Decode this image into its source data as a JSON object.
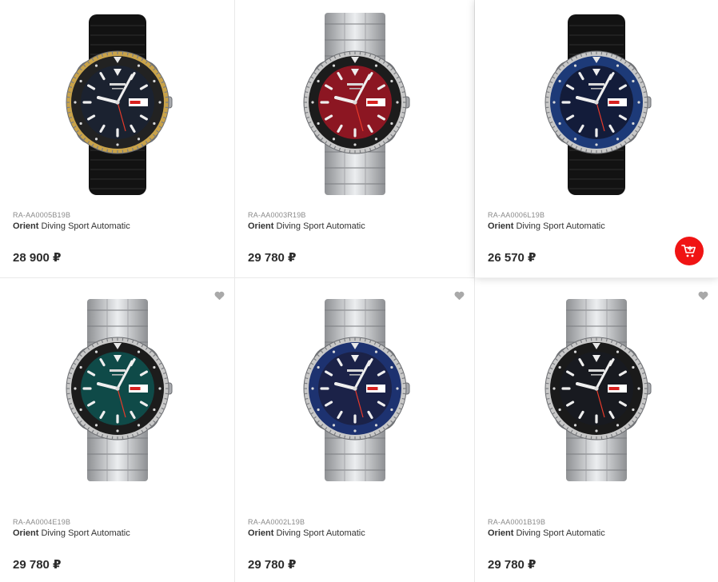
{
  "currency": "₽",
  "accent_color": "#f01414",
  "products": [
    {
      "sku": "RA-AA0005B19B",
      "brand": "Orient",
      "model": "Diving Sport Automatic",
      "price": "28 900 ₽",
      "dial_color": "#1b2230",
      "bezel_color": "#222222",
      "ring_color": "#c9a34a",
      "strap": "rubber",
      "favorite_icon": false,
      "cart_icon": false
    },
    {
      "sku": "RA-AA0003R19B",
      "brand": "Orient",
      "model": "Diving Sport Automatic",
      "price": "29 780 ₽",
      "dial_color": "#8c1622",
      "bezel_color": "#1c1c1c",
      "ring_color": "#c8c8c8",
      "strap": "steel",
      "favorite_icon": false,
      "cart_icon": false
    },
    {
      "sku": "RA-AA0006L19B",
      "brand": "Orient",
      "model": "Diving Sport Automatic",
      "price": "26 570 ₽",
      "dial_color": "#131c3a",
      "bezel_color": "#1d3a78",
      "ring_color": "#c8c8c8",
      "strap": "rubber",
      "favorite_icon": false,
      "cart_icon": true
    },
    {
      "sku": "RA-AA0004E19B",
      "brand": "Orient",
      "model": "Diving Sport Automatic",
      "price": "29 780 ₽",
      "dial_color": "#0f4a48",
      "bezel_color": "#1c1c1c",
      "ring_color": "#c8c8c8",
      "strap": "steel",
      "favorite_icon": true,
      "cart_icon": false
    },
    {
      "sku": "RA-AA0002L19B",
      "brand": "Orient",
      "model": "Diving Sport Automatic",
      "price": "29 780 ₽",
      "dial_color": "#1b2248",
      "bezel_color": "#1d3270",
      "ring_color": "#c8c8c8",
      "strap": "steel",
      "favorite_icon": true,
      "cart_icon": false
    },
    {
      "sku": "RA-AA0001B19B",
      "brand": "Orient",
      "model": "Diving Sport Automatic",
      "price": "29 780 ₽",
      "dial_color": "#181a20",
      "bezel_color": "#1a1a1a",
      "ring_color": "#c8c8c8",
      "strap": "steel",
      "favorite_icon": true,
      "cart_icon": false
    }
  ]
}
